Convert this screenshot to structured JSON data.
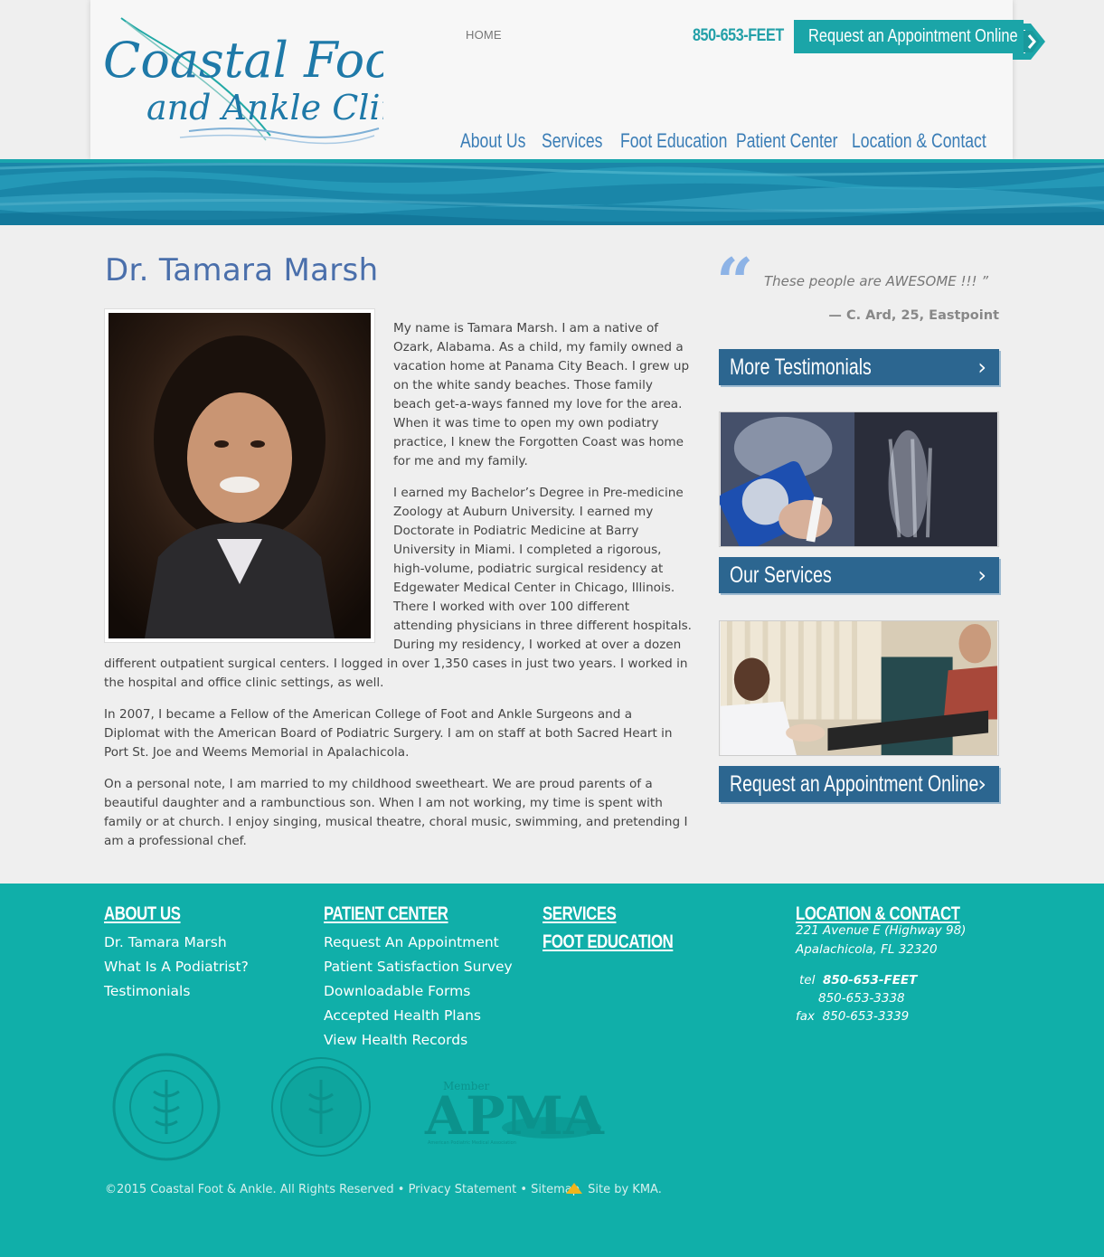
{
  "header": {
    "logo_alt_line1": "Coastal Foot",
    "logo_alt_line2": "and Ankle Clinic",
    "home_link": "HOME",
    "phone": "850-653-FEET",
    "appointment_button": "Request an Appointment Online",
    "nav": [
      "About Us",
      "Services",
      "Foot Education",
      "Patient Center",
      "Location & Contact"
    ]
  },
  "main": {
    "title": "Dr. Tamara Marsh",
    "paragraphs": [
      "My name is Tamara Marsh. I am a native of Ozark, Alabama. As a child, my family owned a vacation home at Panama City Beach. I grew up on the white sandy beaches. Those family beach get-a-ways fanned my love for the area. When it was time to open my own podiatry practice, I knew the Forgotten Coast was home for me and my family.",
      "I earned my Bachelor’s Degree in Pre-medicine Zoology at Auburn University. I earned my Doctorate in Podiatric Medicine at Barry University in Miami. I completed a rigorous, high-volume, podiatric surgical residency at Edgewater Medical Center in Chicago, Illinois. There I worked with over 100 different attending physicians in three different hospitals. During my residency, I worked at over a dozen different outpatient surgical centers. I logged in over 1,350 cases in just two years. I worked in the hospital and office clinic settings, as well.",
      "In 2007, I became a Fellow of the American College of Foot and Ankle Surgeons and a Diplomat with the American Board of Podiatric Surgery. I am on staff at both Sacred Heart in Port St. Joe and Weems Memorial in Apalachicola.",
      "On a personal note, I am married to my childhood sweetheart. We are proud parents of a beautiful daughter and a rambunctious son. When I am not working, my time is spent with family or at church. I enjoy singing, musical theatre, choral music, swimming, and pretending I am a professional chef."
    ]
  },
  "sidebar": {
    "quote_text": "These people are AWESOME !!! ”",
    "quote_author": "— C. Ard, 25, Eastpoint",
    "buttons": [
      "More Testimonials",
      "Our Services",
      "Request an Appointment Online"
    ],
    "chevron": "›"
  },
  "footer": {
    "about": {
      "heading": "ABOUT US",
      "links": [
        "Dr. Tamara Marsh",
        "What Is A Podiatrist?",
        "Testimonials"
      ]
    },
    "patient": {
      "heading": "PATIENT CENTER",
      "links": [
        "Request An Appointment",
        "Patient Satisfaction Survey",
        "Downloadable Forms",
        "Accepted Health Plans",
        "View Health Records"
      ]
    },
    "services_heading": "SERVICES",
    "education_heading": "FOOT EDUCATION",
    "location": {
      "heading": "LOCATION & CONTACT",
      "address1": "221 Avenue E (Highway 98)",
      "address2": "Apalachicola, FL 32320",
      "tel_label": "tel",
      "tel": "850-653-FEET",
      "tel2": "850-653-3338",
      "fax_label": "fax",
      "fax": "850-653-3339"
    },
    "apma_member": "Member",
    "apma": "APMA",
    "apma_sub": "American Podiatric Medical Association",
    "copyright": "©2015 Coastal Foot & Ankle. All Rights Reserved • Privacy Statement • Sitemap",
    "sitebykma": "Site by KMA."
  },
  "colors": {
    "teal": "#10afa9",
    "navy_button": "#2c6690",
    "title_blue": "#4a6fab",
    "nav_blue": "#3a7db6"
  }
}
